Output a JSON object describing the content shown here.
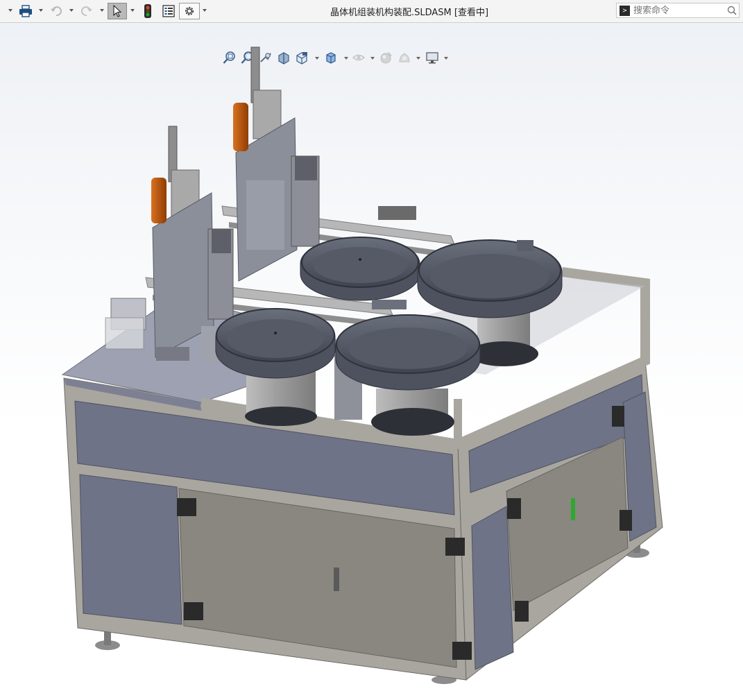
{
  "window": {
    "title": "晶体机组装机构装配.SLDASM [查看中]"
  },
  "search": {
    "placeholder": "搜索命令"
  },
  "toolbar": {
    "items": [
      "print-icon",
      "undo-icon",
      "redo-icon",
      "select-cursor-icon",
      "traffic-light-icon",
      "file-properties-icon",
      "options-gear-icon"
    ]
  },
  "view_toolbar": {
    "items": [
      "zoom-to-fit-icon",
      "zoom-to-area-icon",
      "previous-view-icon",
      "section-view-icon",
      "view-orientation-icon",
      "display-style-icon",
      "hide-show-items-icon",
      "edit-appearance-icon",
      "apply-scene-icon",
      "view-settings-icon"
    ]
  },
  "colors": {
    "panel_blue": "#6e7387",
    "frame_gray": "#a9a6a0",
    "door_gray": "#8a8781",
    "bowl_dark": "#555a66",
    "cylinder_gray": "#9e9e9e",
    "motor_orange": "#c25a10",
    "accent_green": "#2fa82f"
  }
}
